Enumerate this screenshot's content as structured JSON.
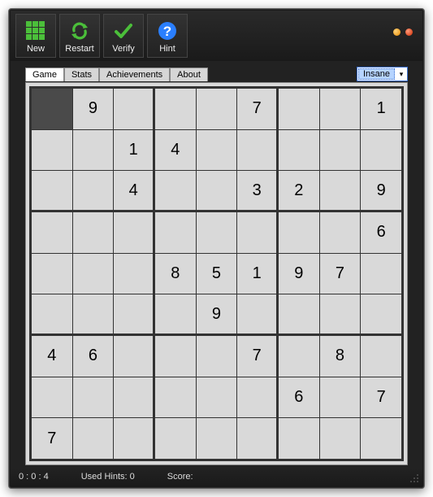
{
  "toolbar": {
    "new_label": "New",
    "restart_label": "Restart",
    "verify_label": "Verify",
    "hint_label": "Hint"
  },
  "tabs": {
    "game": "Game",
    "stats": "Stats",
    "achievements": "Achievements",
    "about": "About"
  },
  "difficulty": {
    "selected": "Insane"
  },
  "board": {
    "selected_cell": [
      0,
      0
    ],
    "grid": [
      [
        "",
        "9",
        "",
        "",
        "",
        "7",
        "",
        "",
        "1",
        ""
      ],
      [
        "",
        "",
        "1",
        "4",
        "",
        "",
        "",
        "",
        ""
      ],
      [
        "",
        "",
        "4",
        "",
        "",
        "3",
        "2",
        "",
        "9"
      ],
      [
        "",
        "",
        "",
        "",
        "",
        "",
        "",
        "",
        "6"
      ],
      [
        "",
        "",
        "",
        "8",
        "5",
        "1",
        "9",
        "7",
        ""
      ],
      [
        "",
        "",
        "",
        "",
        "9",
        "",
        "",
        "",
        ""
      ],
      [
        "4",
        "6",
        "",
        "",
        "",
        "7",
        "",
        "8",
        ""
      ],
      [
        "",
        "",
        "",
        "",
        "",
        "",
        "6",
        "",
        "7"
      ],
      [
        "7",
        "",
        "",
        "",
        "",
        "",
        "",
        "",
        ""
      ]
    ]
  },
  "status": {
    "timer": "0 : 0 : 4",
    "hints_label": "Used Hints:",
    "hints_value": "0",
    "score_label": "Score:",
    "score_value": ""
  },
  "colors": {
    "accent_green": "#4bbf3a",
    "accent_blue": "#2a7fff",
    "grid_bg": "#d9d9d9"
  }
}
